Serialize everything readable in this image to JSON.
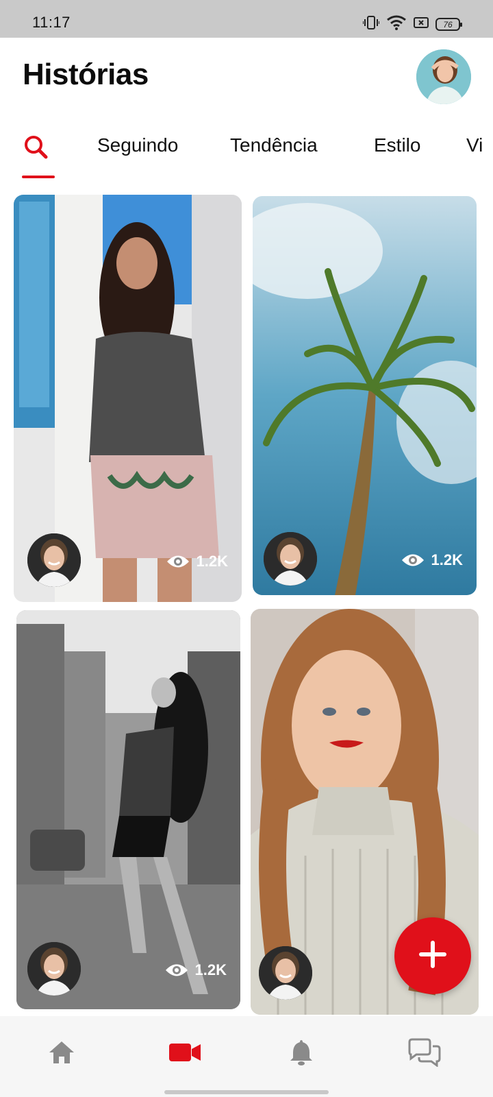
{
  "status_bar": {
    "time": "11:17",
    "battery": "76"
  },
  "header": {
    "title": "Histórias"
  },
  "tabs": [
    {
      "label": "Seguindo"
    },
    {
      "label": "Tendência"
    },
    {
      "label": "Estilo"
    },
    {
      "label": "Vi"
    }
  ],
  "cards": [
    {
      "views": "1.2K"
    },
    {
      "views": "1.2K"
    },
    {
      "views": "1.2K"
    },
    {
      "views": ""
    }
  ],
  "colors": {
    "accent": "#e0101a",
    "nav_icon": "#8a8a8a"
  },
  "icons": {
    "search": "search-icon",
    "eye": "eye-icon",
    "add": "plus-icon",
    "home": "home-icon",
    "video": "video-camera-icon",
    "bell": "bell-icon",
    "chat": "chat-bubbles-icon"
  }
}
